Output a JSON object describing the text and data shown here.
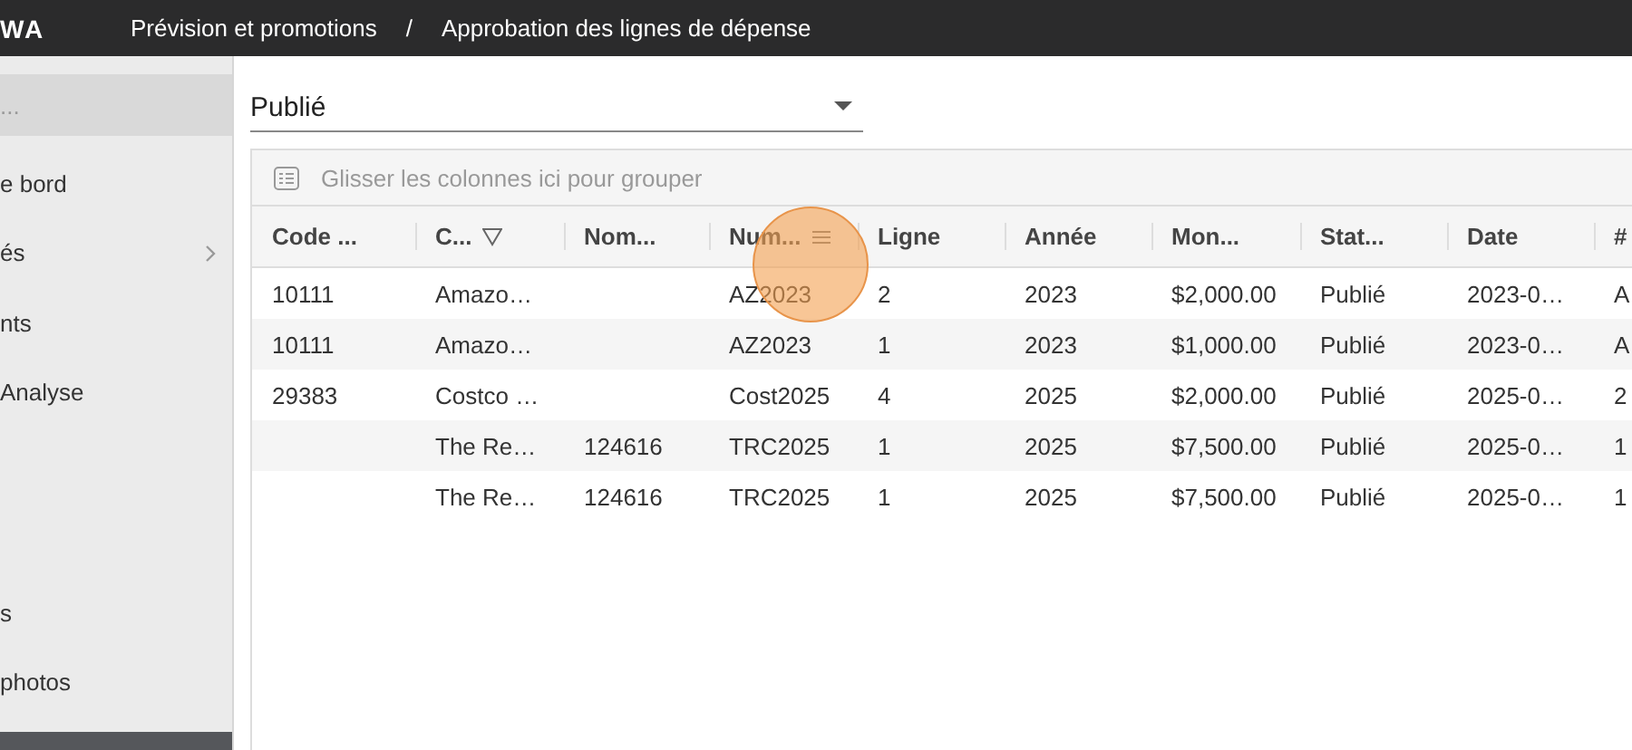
{
  "header": {
    "logo": "WA",
    "breadcrumbs": [
      "Prévision et promotions",
      "Approbation des lignes de dépense"
    ],
    "separator": "/"
  },
  "sidebar": {
    "search": {
      "placeholder": "..."
    },
    "items": [
      {
        "label": "e bord",
        "has_children": false
      },
      {
        "label": "és",
        "has_children": true
      },
      {
        "label": "nts",
        "has_children": false
      },
      {
        "label": "Analyse",
        "has_children": false
      }
    ],
    "bottom_items": [
      {
        "label": "s",
        "has_children": false
      },
      {
        "label": "photos",
        "has_children": false
      }
    ]
  },
  "filter": {
    "value": "Publié"
  },
  "grid": {
    "group_hint": "Glisser les colonnes ici pour grouper",
    "columns": [
      {
        "label": "Code ...",
        "filter": false,
        "menu": false
      },
      {
        "label": "C...",
        "filter": true,
        "menu": false
      },
      {
        "label": "Nom...",
        "filter": false,
        "menu": false
      },
      {
        "label": "Num...",
        "filter": false,
        "menu": true
      },
      {
        "label": "Ligne",
        "filter": false,
        "menu": false
      },
      {
        "label": "Année",
        "filter": false,
        "menu": false
      },
      {
        "label": "Mon...",
        "filter": false,
        "menu": false
      },
      {
        "label": "Stat...",
        "filter": false,
        "menu": false
      },
      {
        "label": "Date",
        "filter": false,
        "menu": false
      },
      {
        "label": "#"
      }
    ],
    "rows": [
      [
        "10111",
        "Amazo…",
        "",
        "AZ2023",
        "2",
        "2023",
        "$2,000.00",
        "Publié",
        "2023-0…",
        "A"
      ],
      [
        "10111",
        "Amazo…",
        "",
        "AZ2023",
        "1",
        "2023",
        "$1,000.00",
        "Publié",
        "2023-0…",
        "A"
      ],
      [
        "29383",
        "Costco …",
        "",
        "Cost2025",
        "4",
        "2025",
        "$2,000.00",
        "Publié",
        "2025-0…",
        "2"
      ],
      [
        "",
        "The Re…",
        "124616",
        "TRC2025",
        "1",
        "2025",
        "$7,500.00",
        "Publié",
        "2025-0…",
        "1"
      ],
      [
        "",
        "The Re…",
        "124616",
        "TRC2025",
        "1",
        "2025",
        "$7,500.00",
        "Publié",
        "2025-0…",
        "1"
      ]
    ]
  }
}
